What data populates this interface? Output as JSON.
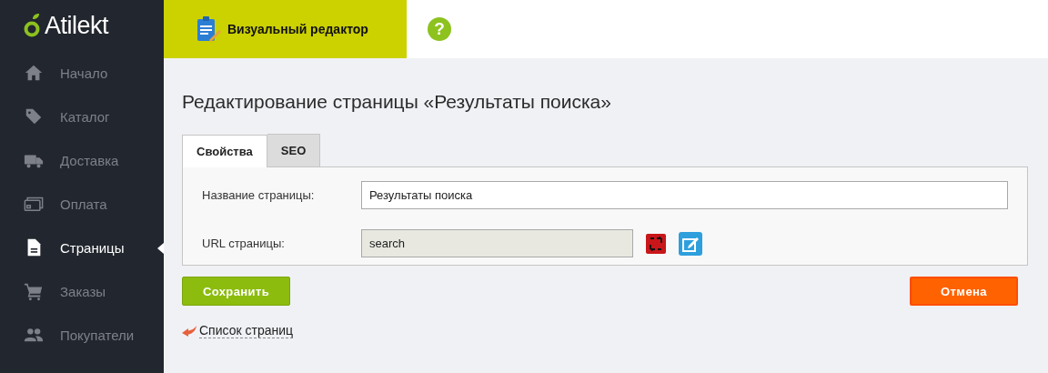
{
  "logo": {
    "text": "Atilekt"
  },
  "sidebar": {
    "items": [
      {
        "label": "Начало",
        "selected": false
      },
      {
        "label": "Каталог",
        "selected": false
      },
      {
        "label": "Доставка",
        "selected": false
      },
      {
        "label": "Оплата",
        "selected": false
      },
      {
        "label": "Страницы",
        "selected": true
      },
      {
        "label": "Заказы",
        "selected": false
      },
      {
        "label": "Покупатели",
        "selected": false
      }
    ]
  },
  "topbar": {
    "editor_tab": "Визуальный редактор",
    "help": "?"
  },
  "page_title": "Редактирование страницы «Результаты поиска»",
  "tabs": [
    {
      "label": "Свойства",
      "selected": true
    },
    {
      "label": "SEO",
      "selected": false
    }
  ],
  "form": {
    "fields": [
      {
        "label": "Название страницы:",
        "value": "Результаты поиска",
        "disabled": false
      },
      {
        "label": "URL страницы:",
        "value": "search",
        "disabled": true
      }
    ]
  },
  "buttons": {
    "save": "Сохранить",
    "cancel": "Отмена"
  },
  "back_link": "Список страниц"
}
